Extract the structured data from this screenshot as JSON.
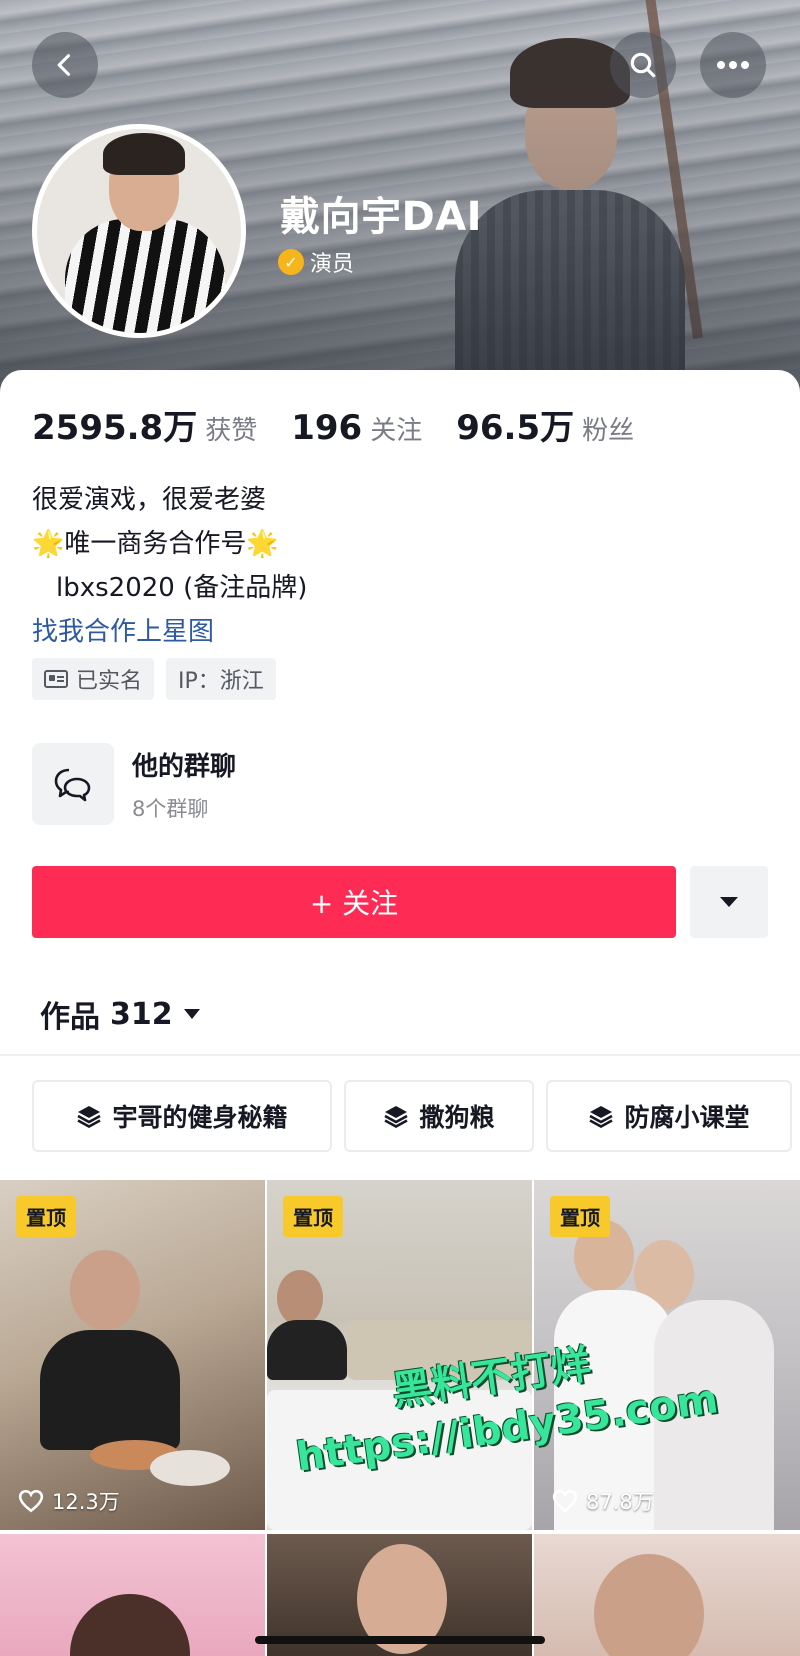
{
  "header": {
    "nickname": "戴向宇DAI",
    "verify_label": "演员",
    "verify_color": "#f6b51b"
  },
  "stats": [
    {
      "value": "2595.8万",
      "label": "获赞"
    },
    {
      "value": "196",
      "label": "关注"
    },
    {
      "value": "96.5万",
      "label": "粉丝"
    }
  ],
  "bio": {
    "line1": "很爱演戏，很爱老婆",
    "line2_star": "🌟",
    "line2": "唯一商务合作号",
    "line3": "lbxs2020 (备注品牌)",
    "link": "找我合作上星图"
  },
  "tags": {
    "realname": "已实名",
    "ip": "IP：浙江"
  },
  "group_chat": {
    "title": "他的群聊",
    "subtitle": "8个群聊"
  },
  "actions": {
    "follow_label": "+ 关注",
    "follow_color": "#fe2c55"
  },
  "works": {
    "label": "作品",
    "count": "312"
  },
  "collections": [
    {
      "label": "宇哥的健身秘籍"
    },
    {
      "label": "撒狗粮"
    },
    {
      "label": "防腐小课堂"
    }
  ],
  "videos": [
    {
      "pinned": "置顶",
      "likes": "12.3万"
    },
    {
      "pinned": "置顶",
      "likes": ""
    },
    {
      "pinned": "置顶",
      "likes": "87.8万"
    }
  ],
  "watermark": {
    "line1": "黑料不打烊",
    "line2": "https://ibdy35.com"
  },
  "icons": {
    "back": "chevron-left-icon",
    "search": "search-icon",
    "more": "more-dots-icon",
    "chat": "chat-bubbles-icon",
    "stack": "stack-layers-icon",
    "heart": "heart-icon",
    "dropdown": "caret-down-icon"
  }
}
